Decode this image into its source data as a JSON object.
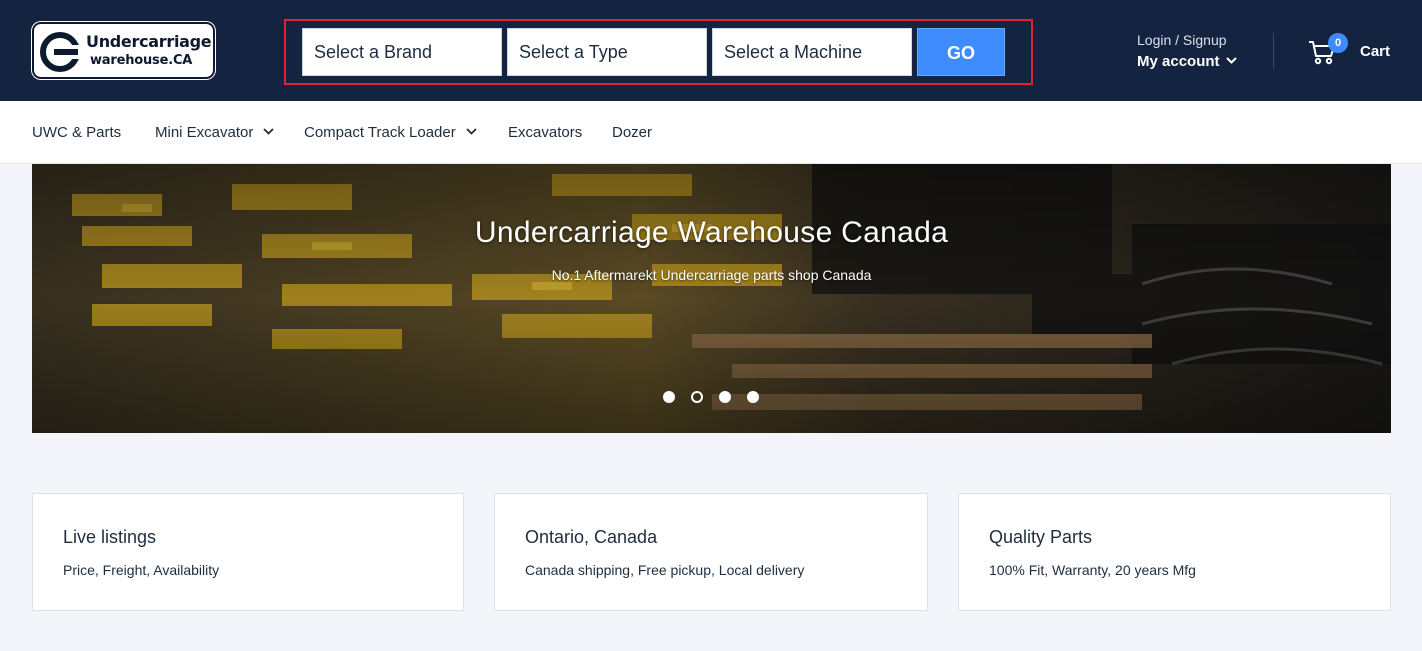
{
  "header": {
    "logo": {
      "line1": "Undercarriage",
      "line2": "warehouse.CA"
    },
    "search": {
      "brand": "Select a Brand",
      "type": "Select a Type",
      "machine": "Select a Machine",
      "go": "GO"
    },
    "account": {
      "login": "Login / Signup",
      "label": "My account"
    },
    "cart": {
      "count": "0",
      "label": "Cart"
    }
  },
  "nav": {
    "items": [
      {
        "label": "UWC & Parts"
      },
      {
        "label": "Mini Excavator"
      },
      {
        "label": "Compact Track Loader"
      },
      {
        "label": "Excavators"
      },
      {
        "label": "Dozer"
      }
    ]
  },
  "hero": {
    "title": "Undercarriage Warehouse Canada",
    "subtitle": "No.1 Aftermarekt Undercarriage parts shop Canada",
    "slides": 4,
    "active_slide": 2
  },
  "features": [
    {
      "title": "Live listings",
      "text": "Price, Freight, Availability"
    },
    {
      "title": "Ontario, Canada",
      "text": "Canada shipping, Free pickup, Local delivery"
    },
    {
      "title": "Quality Parts",
      "text": "100% Fit, Warranty, 20 years Mfg"
    }
  ],
  "colors": {
    "header_bg": "#142440",
    "accent": "#3d8bfd",
    "highlight_border": "#e0232f"
  }
}
